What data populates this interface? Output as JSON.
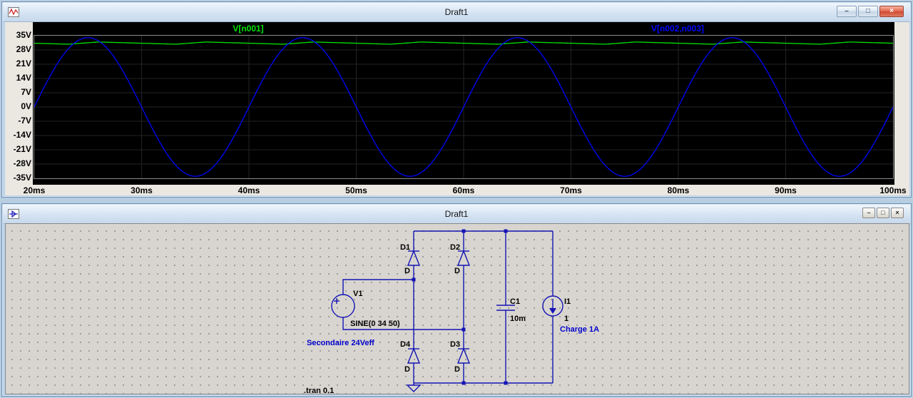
{
  "chrome": {
    "minimize_glyph": "–",
    "maximize_glyph": "□",
    "close_glyph": "×"
  },
  "plot_window": {
    "title": "Draft1"
  },
  "chart_data": {
    "type": "line",
    "background": "#000000",
    "grid_color": "#232323",
    "x_unit": "ms",
    "x_range_ms": [
      20,
      100
    ],
    "x_tick_step_ms": 10,
    "x_ticks": [
      "20ms",
      "30ms",
      "40ms",
      "50ms",
      "60ms",
      "70ms",
      "80ms",
      "90ms",
      "100ms"
    ],
    "y_unit": "V",
    "y_range_V": [
      -35,
      35
    ],
    "y_tick_step_V": 7,
    "y_ticks": [
      "35V",
      "28V",
      "21V",
      "14V",
      "7V",
      "0V",
      "-7V",
      "-14V",
      "-21V",
      "-28V",
      "-35V"
    ],
    "series": [
      {
        "name": "V[n001]",
        "color": "#00e400",
        "shape": "rectified_ripple",
        "peak_V": 31.9,
        "ripple_V": 1.1,
        "ripple_period_ms": 10,
        "peak_time_ms": 26,
        "discharge_fraction": 0.72,
        "description": "Filtered bridge-rectifier output, approx 31.5 V DC with small 100 Hz ripple"
      },
      {
        "name": "V[n002,n003]",
        "color": "#0000ff",
        "shape": "sine",
        "amplitude_V": 34,
        "frequency_Hz": 50,
        "offset_V": 0,
        "description": "Transformer secondary voltage, 34 V peak, 50 Hz"
      }
    ]
  },
  "schematic_window": {
    "title": "Draft1",
    "wire_color": "#1414b4",
    "components": {
      "V1": {
        "name": "V1",
        "value": "SINE(0 34 50)"
      },
      "D1": {
        "name": "D1",
        "model": "D"
      },
      "D2": {
        "name": "D2",
        "model": "D"
      },
      "D3": {
        "name": "D3",
        "model": "D"
      },
      "D4": {
        "name": "D4",
        "model": "D"
      },
      "C1": {
        "name": "C1",
        "value": "10m"
      },
      "I1": {
        "name": "I1",
        "value": "1"
      }
    },
    "annotations": {
      "secondary": "Secondaire 24Veff",
      "load": "Charge 1A"
    },
    "directive": ".tran 0.1"
  }
}
